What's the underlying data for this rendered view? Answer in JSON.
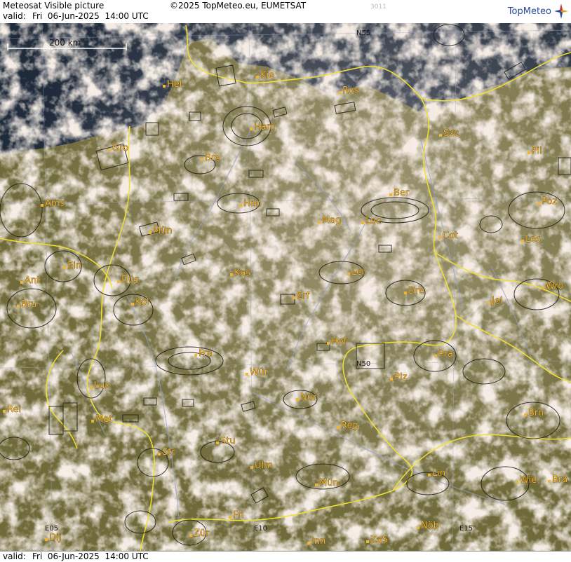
{
  "header": {
    "title": "Meteosat Visible picture",
    "copyright": "©2025 TopMeteo.eu, EUMETSAT",
    "code": "3011",
    "valid_label": "valid:",
    "valid_value": "Fri  06-Jun-2025  14:00 UTC",
    "logo_text": "TopMeteo"
  },
  "footer": {
    "valid_label": "valid:",
    "valid_value": "Fri  06-Jun-2025  14:00 UTC"
  },
  "scale": {
    "label": "200 km"
  },
  "grid_labels": {
    "n55": "N55",
    "n50": "N50",
    "e05": "E05",
    "e10": "E10",
    "e15": "E15"
  },
  "cities": [
    {
      "id": "hel",
      "name": "Hel"
    },
    {
      "id": "kie",
      "name": "Kie"
    },
    {
      "id": "ros",
      "name": "Ros"
    },
    {
      "id": "ham",
      "name": "Ham"
    },
    {
      "id": "szc",
      "name": "Szc"
    },
    {
      "id": "gro",
      "name": "Gro"
    },
    {
      "id": "bre",
      "name": "Bre"
    },
    {
      "id": "pil",
      "name": "Pil"
    },
    {
      "id": "ams",
      "name": "Ams"
    },
    {
      "id": "han",
      "name": "Han"
    },
    {
      "id": "ber",
      "name": "Ber"
    },
    {
      "id": "poz",
      "name": "Poz"
    },
    {
      "id": "mun-n",
      "name": "Mün"
    },
    {
      "id": "mag",
      "name": "Mag"
    },
    {
      "id": "loc",
      "name": "Loc"
    },
    {
      "id": "cot",
      "name": "Cot"
    },
    {
      "id": "les",
      "name": "Les"
    },
    {
      "id": "ein",
      "name": "Ein"
    },
    {
      "id": "kas",
      "name": "Kas"
    },
    {
      "id": "lei",
      "name": "Lei"
    },
    {
      "id": "ant",
      "name": "Ant"
    },
    {
      "id": "dus",
      "name": "Düs"
    },
    {
      "id": "dre",
      "name": "Dre"
    },
    {
      "id": "wro",
      "name": "Wro"
    },
    {
      "id": "bru",
      "name": "Bru"
    },
    {
      "id": "kol",
      "name": "Köl"
    },
    {
      "id": "erf",
      "name": "Erf"
    },
    {
      "id": "jel",
      "name": "Jel"
    },
    {
      "id": "hof",
      "name": "Hof"
    },
    {
      "id": "fra",
      "name": "Fra"
    },
    {
      "id": "pra",
      "name": "Pra"
    },
    {
      "id": "plz",
      "name": "Plz"
    },
    {
      "id": "lux",
      "name": "Lux"
    },
    {
      "id": "wur",
      "name": "Wür"
    },
    {
      "id": "nur",
      "name": "Nür"
    },
    {
      "id": "rei",
      "name": "Rei"
    },
    {
      "id": "met",
      "name": "Met"
    },
    {
      "id": "reg",
      "name": "Reg"
    },
    {
      "id": "brn",
      "name": "Brn"
    },
    {
      "id": "stu",
      "name": "Stu"
    },
    {
      "id": "str",
      "name": "Str"
    },
    {
      "id": "ulm",
      "name": "Ulm"
    },
    {
      "id": "lin",
      "name": "Lin"
    },
    {
      "id": "mun-s",
      "name": "Mün"
    },
    {
      "id": "wie",
      "name": "Wie"
    },
    {
      "id": "bra",
      "name": "Bra"
    },
    {
      "id": "fri",
      "name": "Fri"
    },
    {
      "id": "dij",
      "name": "Dij"
    },
    {
      "id": "zur",
      "name": "Zür"
    },
    {
      "id": "inn",
      "name": "Inn"
    },
    {
      "id": "zas",
      "name": "ZaS"
    },
    {
      "id": "nob",
      "name": "Nöb"
    }
  ],
  "colors": {
    "land": "#6f6a3a",
    "cloud": "#e9d6c6",
    "sea": "#1f2a3a",
    "border": "#f0e030",
    "river": "#8fa0d8",
    "city": "#f2b433"
  }
}
